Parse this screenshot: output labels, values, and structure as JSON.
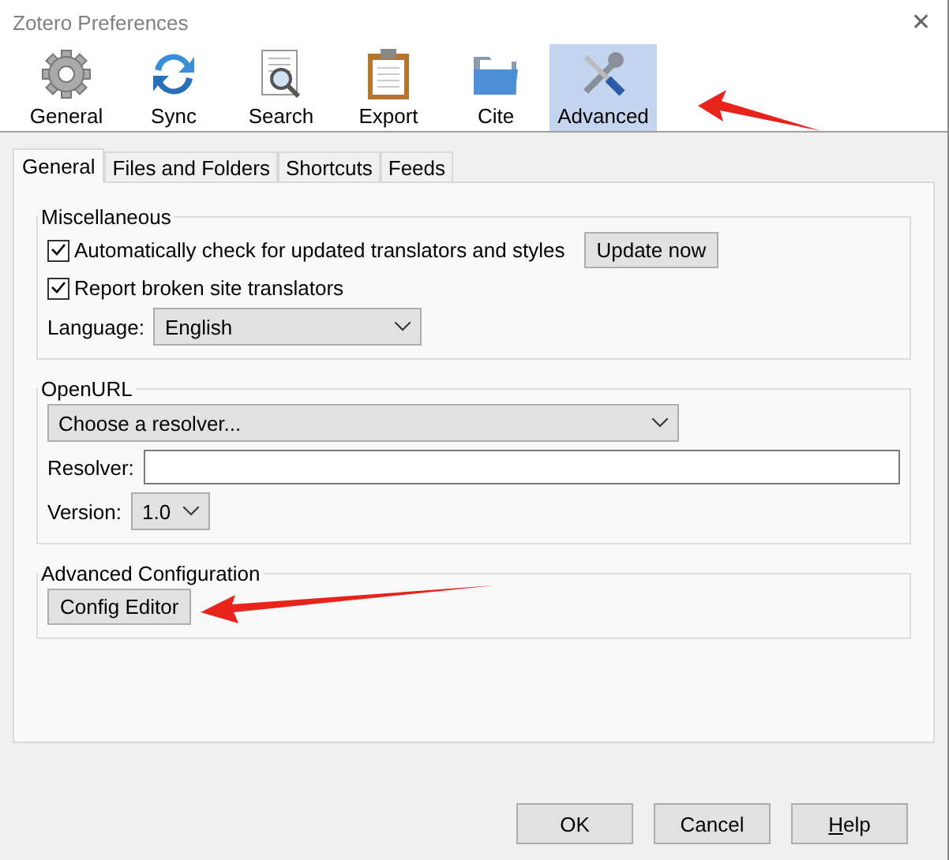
{
  "window": {
    "title": "Zotero Preferences",
    "close": "✕"
  },
  "panes": [
    {
      "label": "General",
      "selected": false
    },
    {
      "label": "Sync",
      "selected": false
    },
    {
      "label": "Search",
      "selected": false
    },
    {
      "label": "Export",
      "selected": false
    },
    {
      "label": "Cite",
      "selected": false
    },
    {
      "label": "Advanced",
      "selected": true
    }
  ],
  "tabs": [
    {
      "label": "General",
      "selected": true
    },
    {
      "label": "Files and Folders",
      "selected": false
    },
    {
      "label": "Shortcuts",
      "selected": false
    },
    {
      "label": "Feeds",
      "selected": false
    }
  ],
  "miscellaneous": {
    "title": "Miscellaneous",
    "auto_check": {
      "label": "Automatically check for updated translators and styles",
      "checked": true
    },
    "update_button": "Update now",
    "report_broken": {
      "label": "Report broken site translators",
      "checked": true
    },
    "language": {
      "label": "Language:",
      "value": "English"
    }
  },
  "openurl": {
    "title": "OpenURL",
    "resolver_select": "Choose a resolver...",
    "resolver": {
      "label": "Resolver:"
    },
    "version": {
      "label": "Version:",
      "value": "1.0"
    }
  },
  "advanced_configuration": {
    "title": "Advanced Configuration",
    "button": "Config Editor"
  },
  "buttons": [
    {
      "label": "OK",
      "access_key_underlined": false
    },
    {
      "label": "Cancel",
      "access_key_underlined": false
    },
    {
      "label": "Help",
      "access_key_underlined": true
    }
  ]
}
